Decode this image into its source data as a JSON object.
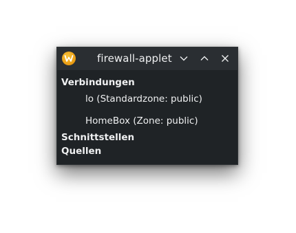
{
  "window": {
    "title": "firewall-applet",
    "app_icon": "firewall-applet-logo-icon",
    "buttons": {
      "minimize_icon": "chevron-down-icon",
      "maximize_icon": "chevron-up-icon",
      "close_icon": "close-icon"
    }
  },
  "sections": {
    "connections": {
      "heading": "Verbindungen",
      "items": [
        "lo (Standardzone: public)",
        "HomeBox (Zone: public)"
      ]
    },
    "interfaces": {
      "heading": "Schnittstellen"
    },
    "sources": {
      "heading": "Quellen"
    }
  },
  "colors": {
    "background": "#1f2326",
    "titlebar": "#2a2e32",
    "text": "#eff0f1",
    "icon_accent": "#f6c23a"
  }
}
